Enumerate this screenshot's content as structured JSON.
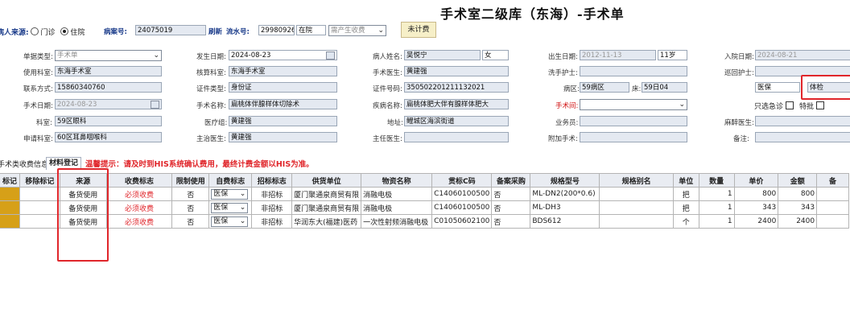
{
  "title": "手术室二级库（东海）-手术单",
  "top_bar": {
    "patient_source_label": "病人来源:",
    "radio_outpatient": "门诊",
    "radio_inpatient": "住院",
    "case_no_label": "病案号:",
    "case_no_value": "24075019",
    "refresh_label": "刷新",
    "serial_label": "流水号:",
    "serial_value": "29980926",
    "status_value": "在院",
    "fee_select_value": "需产生收费",
    "uncharged_button": "未计费"
  },
  "form": {
    "doc_type": {
      "label": "单据类型:",
      "value": "手术单"
    },
    "use_dept": {
      "label": "使用科室:",
      "value": "东海手术室"
    },
    "phone": {
      "label": "联系方式:",
      "value": "15860340760"
    },
    "surgery_date": {
      "label": "手术日期:",
      "value": "2024-08-23"
    },
    "dept": {
      "label": "科室:",
      "value": "59区眼科"
    },
    "apply_dept": {
      "label": "申请科室:",
      "value": "60区耳鼻咽喉科"
    },
    "occur_date": {
      "label": "发生日期:",
      "value": "2024-08-23"
    },
    "check_dept": {
      "label": "核算科室:",
      "value": "东海手术室"
    },
    "cert_type": {
      "label": "证件类型:",
      "value": "身份证"
    },
    "surgery_name": {
      "label": "手术名称:",
      "value": "扁桃体伴腺样体切除术"
    },
    "medical_group": {
      "label": "医疗组:",
      "value": "黄建强"
    },
    "attending": {
      "label": "主治医生:",
      "value": "黄建强"
    },
    "patient_name": {
      "label": "病人姓名:",
      "value": "吴悦宁",
      "gender": "女"
    },
    "surgeon": {
      "label": "手术医生:",
      "value": "黄建强"
    },
    "cert_no": {
      "label": "证件号码:",
      "value": "350502201211132021"
    },
    "disease": {
      "label": "疾病名称:",
      "value": "扁桃体肥大伴有腺样体肥大"
    },
    "address": {
      "label": "地址:",
      "value": "鲤城区海滨街道"
    },
    "chief": {
      "label": "主任医生:",
      "value": ""
    },
    "birth": {
      "label": "出生日期:",
      "value": "2012-11-13",
      "age": "11岁"
    },
    "scrub_nurse": {
      "label": "洗手护士:",
      "value": ""
    },
    "ward": {
      "label": "病区:",
      "value": "59病区",
      "bed_label": "床:",
      "bed_value": "59日04"
    },
    "surgery_room": {
      "label": "手术间:",
      "value": ""
    },
    "clerk": {
      "label": "业务员:",
      "value": ""
    },
    "assist": {
      "label": "附加手术:",
      "value": ""
    },
    "admit_date": {
      "label": "入院日期:",
      "value": "2024-08-21"
    },
    "circ_nurse": {
      "label": "巡回护士:",
      "value": ""
    },
    "insurance_label": "医保",
    "insurance_value": "体检",
    "only_emergency": "只选急诊",
    "special": "特批",
    "anesthetist": {
      "label": "麻醉医生:",
      "value": ""
    },
    "remark": {
      "label": "备注:",
      "value": ""
    }
  },
  "tabs": {
    "tab1": "手术类收费信息",
    "tab2": "材料登记",
    "tip": "温馨提示：请及时到HIS系统确认费用，最终计费金额以HIS为准。"
  },
  "table": {
    "headers": [
      "标记",
      "移除标记",
      "来源",
      "收费标志",
      "限制使用",
      "自费标志",
      "招标标志",
      "供货单位",
      "物资名称",
      "贯标C码",
      "备案采购",
      "规格型号",
      "规格别名",
      "单位",
      "数量",
      "单价",
      "金额",
      "备"
    ],
    "rows": [
      {
        "source": "备货使用",
        "fee": "必须收费",
        "limit": "否",
        "self": "医保",
        "bid": "非招标",
        "supplier": "厦门聚通泉商贸有限",
        "item": "消融电极",
        "code": "C14060100500",
        "filing": "否",
        "spec": "ML-DN2(200*0.6)",
        "alias": "",
        "unit": "把",
        "qty": "1",
        "price": "800",
        "amount": "800"
      },
      {
        "source": "备货使用",
        "fee": "必须收费",
        "limit": "否",
        "self": "医保",
        "bid": "非招标",
        "supplier": "厦门聚通泉商贸有限",
        "item": "消融电极",
        "code": "C14060100500",
        "filing": "否",
        "spec": "ML-DH3",
        "alias": "",
        "unit": "把",
        "qty": "1",
        "price": "343",
        "amount": "343"
      },
      {
        "source": "备货使用",
        "fee": "必须收费",
        "limit": "否",
        "self": "医保",
        "bid": "非招标",
        "supplier": "华润东大(福建)医药",
        "item": "一次性射频消融电极",
        "code": "C01050602100",
        "filing": "否",
        "spec": "BDS612",
        "alias": "",
        "unit": "个",
        "qty": "1",
        "price": "2400",
        "amount": "2400"
      }
    ]
  },
  "colors": {
    "accent_red": "#e0262b",
    "field_bg": "#e4e9f1",
    "marker": "#d6a018"
  }
}
